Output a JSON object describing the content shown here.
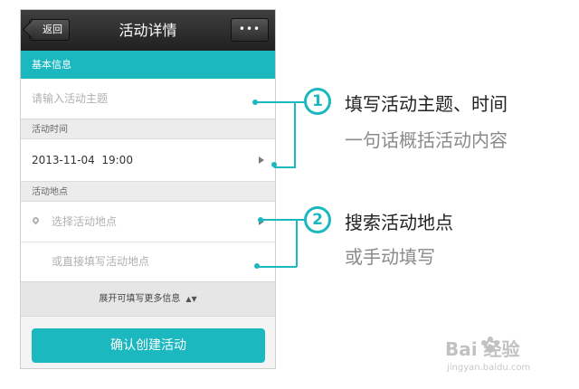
{
  "navbar": {
    "back_label": "返回",
    "title": "活动详情",
    "more_label": "•••"
  },
  "sections": {
    "basic_info": "基本信息",
    "activity_time": "活动时间",
    "activity_location": "活动地点"
  },
  "fields": {
    "topic_placeholder": "请输入活动主题",
    "datetime_value": "2013-11-04  19:00",
    "location_placeholder": "选择活动地点",
    "location_manual_placeholder": "或直接填写活动地点"
  },
  "expand_label": "展开可填写更多信息",
  "expand_icon": "updown-chevron-icon",
  "confirm_label": "确认创建活动",
  "callouts": [
    {
      "number": "1",
      "title": "填写活动主题、时间",
      "subtitle": "一句话概括活动内容"
    },
    {
      "number": "2",
      "title": "搜索活动地点",
      "subtitle": "或手动填写"
    }
  ],
  "watermark": {
    "logo_text": "Bai  经验",
    "url": "jingyan.baidu.com"
  },
  "colors": {
    "accent": "#1bb8c0",
    "navbar": "#2b2b2b"
  }
}
